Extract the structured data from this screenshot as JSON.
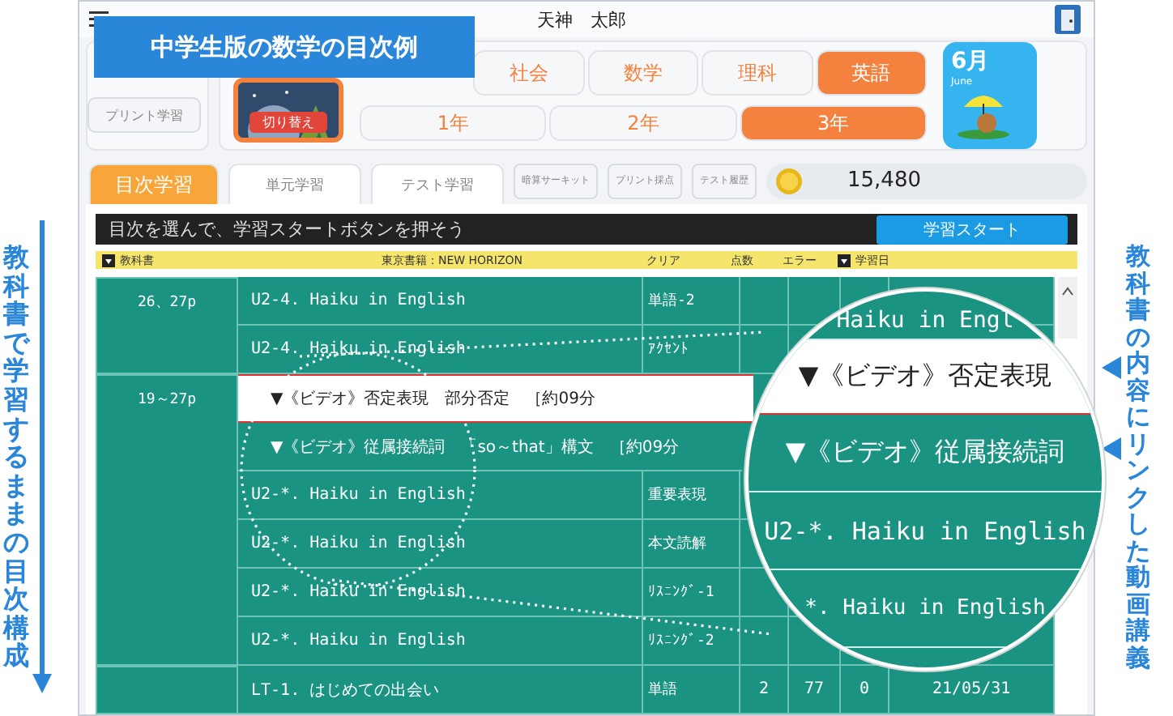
{
  "badge": "中学生版の数学の目次例",
  "user_name": "天神　太郎",
  "left_caption": "教科書で学習するままの目次構成",
  "right_caption": "教科書の内容にリンクした動画講義",
  "print_button": "プリント学習",
  "card_button": "切り替え",
  "subjects": [
    {
      "label": "社会",
      "selected": false
    },
    {
      "label": "数学",
      "selected": false
    },
    {
      "label": "理科",
      "selected": false
    },
    {
      "label": "英語",
      "selected": true
    }
  ],
  "grades": [
    {
      "label": "1年",
      "selected": false
    },
    {
      "label": "2年",
      "selected": false
    },
    {
      "label": "3年",
      "selected": true
    }
  ],
  "calendar": {
    "month": "6月",
    "english": "June"
  },
  "tabs": [
    {
      "label": "目次学習",
      "selected": true
    },
    {
      "label": "単元学習",
      "selected": false
    },
    {
      "label": "テスト学習",
      "selected": false
    }
  ],
  "tools": [
    "暗算サーキット",
    "プリント採点",
    "テスト履歴"
  ],
  "points": "15,480",
  "instruction": "目次を選んで、学習スタートボタンを押そう",
  "start_button": "学習スタート",
  "table": {
    "columns": [
      {
        "label": "教科書",
        "sortable": true
      },
      {
        "label": "東京書籍：NEW HORIZON",
        "sortable": false
      },
      {
        "label": "クリア",
        "sortable": false
      },
      {
        "label": "点数",
        "sortable": false
      },
      {
        "label": "エラー",
        "sortable": false
      },
      {
        "label": "学習日",
        "sortable": true
      }
    ],
    "groups": [
      {
        "page": "26、27p",
        "rows": [
          {
            "kind": "lesson",
            "selected": false,
            "title": "U2-4. Haiku in English",
            "type": "単語-2"
          },
          {
            "kind": "lesson",
            "selected": false,
            "title": "U2-4. Haiku in English",
            "type": "ｱｸｾﾝﾄ"
          }
        ]
      },
      {
        "page": "19～27p",
        "rows": [
          {
            "kind": "video",
            "selected": true,
            "title": "▼《ビデオ》否定表現　部分否定",
            "duration": "［約09分"
          },
          {
            "kind": "video",
            "selected": false,
            "title": "▼《ビデオ》従属接続詞　「so～that」構文",
            "duration": "［約09分"
          },
          {
            "kind": "lesson",
            "selected": false,
            "title": "U2-*. Haiku in English",
            "type": "重要表現"
          },
          {
            "kind": "lesson",
            "selected": false,
            "title": "U2-*. Haiku in English",
            "type": "本文読解"
          },
          {
            "kind": "lesson",
            "selected": false,
            "title": "U2-*. Haiku in English",
            "type": "ﾘｽﾆﾝｸﾞ-1"
          },
          {
            "kind": "lesson",
            "selected": false,
            "title": "U2-*. Haiku in English",
            "type": "ﾘｽﾆﾝｸﾞ-2"
          }
        ]
      },
      {
        "rows": [
          {
            "kind": "lesson",
            "selected": false,
            "title": "LT-1. はじめての出会い",
            "type": "単語",
            "clear": "2",
            "score": "77",
            "error": "0",
            "date": "21/05/31"
          }
        ]
      }
    ]
  },
  "magnifier": [
    {
      "kind": "lesson",
      "selected": false,
      "text": "Haiku in Engl"
    },
    {
      "kind": "video",
      "selected": true,
      "text": "▼《ビデオ》否定表現"
    },
    {
      "kind": "video",
      "selected": false,
      "text": "▼《ビデオ》従属接続詞"
    },
    {
      "kind": "lesson",
      "selected": false,
      "text": "U2-*. Haiku in English"
    },
    {
      "kind": "lesson",
      "selected": false,
      "text": "*. Haiku in English"
    }
  ]
}
